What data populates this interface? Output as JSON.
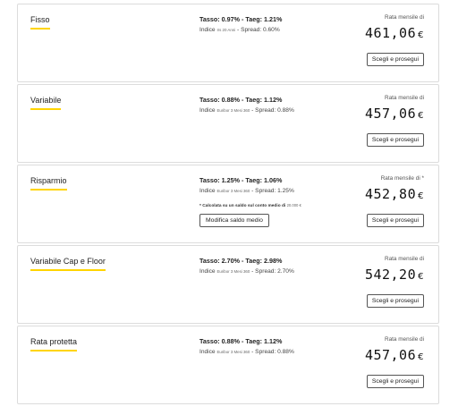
{
  "offers": [
    {
      "name": "Fisso",
      "rates": "Tasso: 0.97% - Taeg: 1.21%",
      "index_label": "Indice",
      "index_detail": "Irs 20 Anni",
      "spread": "- Spread: 0.60%",
      "monthly_label": "Rata mensile di",
      "monthly_value": "461,06",
      "currency": "€",
      "cta_label": "Scegli e prosegui"
    },
    {
      "name": "Variabile",
      "rates": "Tasso: 0.88% - Taeg: 1.12%",
      "index_label": "Indice",
      "index_detail": "Euribor 3 Mesi 360",
      "spread": "- Spread: 0.88%",
      "monthly_label": "Rata mensile di",
      "monthly_value": "457,06",
      "currency": "€",
      "cta_label": "Scegli e prosegui"
    },
    {
      "name": "Risparmio",
      "rates": "Tasso: 1.25% - Taeg: 1.06%",
      "index_label": "Indice",
      "index_detail": "Euribor 3 Mesi 360",
      "spread": "- Spread: 1.25%",
      "note": "* Calcolata su un saldo sul conto medio di",
      "note_amount": "20.000 €",
      "modify_label": "Modifica saldo medio",
      "monthly_label": "Rata mensile di *",
      "monthly_value": "452,80",
      "currency": "€",
      "cta_label": "Scegli e prosegui"
    },
    {
      "name": "Variabile Cap e Floor",
      "rates": "Tasso: 2.70% - Taeg: 2.98%",
      "index_label": "Indice",
      "index_detail": "Euribor 3 Mesi 360",
      "spread": "- Spread: 2.70%",
      "monthly_label": "Rata mensile di",
      "monthly_value": "542,20",
      "currency": "€",
      "cta_label": "Scegli e prosegui"
    },
    {
      "name": "Rata protetta",
      "rates": "Tasso: 0.88% - Taeg: 1.12%",
      "index_label": "Indice",
      "index_detail": "Euribor 3 Mesi 360",
      "spread": "- Spread: 0.88%",
      "monthly_label": "Rata mensile di",
      "monthly_value": "457,06",
      "currency": "€",
      "cta_label": "Scegli e prosegui"
    }
  ]
}
